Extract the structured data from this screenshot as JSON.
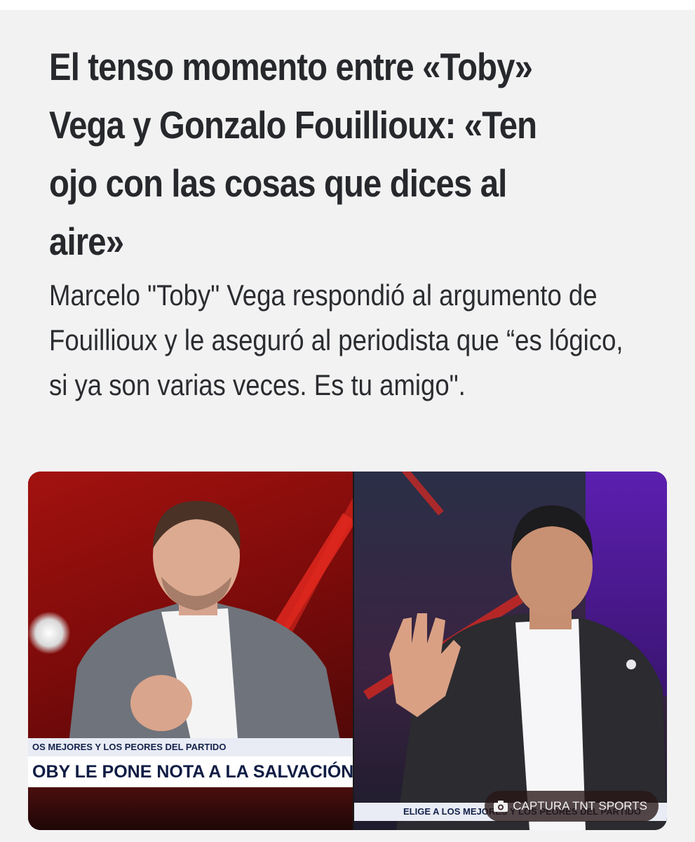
{
  "article": {
    "headline": "El tenso momento entre «Toby» Vega y Gonzalo Fouillioux: «Ten ojo con las cosas que dices al aire»",
    "subheadline": "Marcelo \"Toby\" Vega respondió al argumento de Fouillioux y le aseguró al periodista que “es lógico, si ya son varias veces. Es tu amigo\"."
  },
  "media": {
    "left_ticker_small": "OS MEJORES Y LOS PEORES DEL PARTIDO",
    "left_ticker_main": "OBY LE PONE NOTA A LA SALVACIÓN DE LA U",
    "right_ticker_small": "ELIGE A LOS MEJORES Y LOS PEORES DEL PARTIDO",
    "credit_icon": "camera-icon",
    "credit_text": "CAPTURA TNT SPORTS"
  },
  "colors": {
    "page_background": "#f2f2f2",
    "text": "#26282c",
    "studio_red": "#a3120f",
    "ticker_navy": "#0f1c44"
  }
}
